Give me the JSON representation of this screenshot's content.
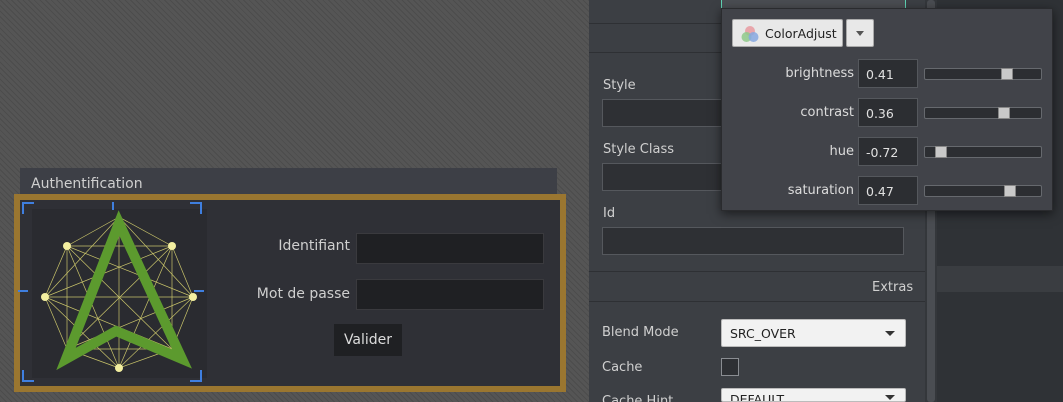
{
  "canvas": {
    "auth_panel": {
      "title": "Authentification",
      "login_label": "Identifiant",
      "login_value": "",
      "password_label": "Mot de passe",
      "password_value": "",
      "submit_label": "Valider"
    }
  },
  "inspector": {
    "style_label": "Style",
    "style_value": "",
    "style_class_label": "Style Class",
    "style_class_value": "",
    "id_label": "Id",
    "id_value": "",
    "extras_header": "Extras",
    "blend_mode_label": "Blend Mode",
    "blend_mode_value": "SRC_OVER",
    "cache_label": "Cache",
    "cache_checked": false,
    "cache_hint_label": "Cache Hint",
    "cache_hint_value": "DEFAULT"
  },
  "effect_popup": {
    "effect_name": "ColorAdjust",
    "properties": [
      {
        "label": "brightness",
        "value": "0.41",
        "level": 0.705
      },
      {
        "label": "contrast",
        "value": "0.36",
        "level": 0.68
      },
      {
        "label": "hue",
        "value": "-0.72",
        "level": 0.14
      },
      {
        "label": "saturation",
        "value": "0.47",
        "level": 0.735
      }
    ]
  },
  "colors": {
    "frame_border": "#9a7630",
    "logo_green": "#5c9a2e",
    "handle_blue": "#3f7fe0",
    "popup_accent": "#5fd3b4"
  },
  "icons": {
    "effect_icon": "color-adjust-icon",
    "dropdown": "chevron-down-icon"
  }
}
